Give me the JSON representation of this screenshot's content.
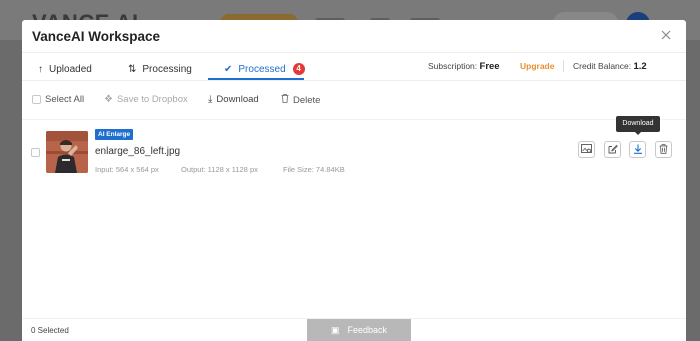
{
  "background": {
    "logo": "VANCE AI"
  },
  "modal": {
    "title": "VanceAI Workspace",
    "close_icon": "close-icon"
  },
  "tabs": [
    {
      "label": "Uploaded",
      "icon": "upload-arrow-icon"
    },
    {
      "label": "Processing",
      "icon": "sync-icon"
    },
    {
      "label": "Processed",
      "icon": "check-circle-icon",
      "badge": "4",
      "active": true
    }
  ],
  "account": {
    "subscription_label": "Subscription:",
    "subscription_value": "Free",
    "upgrade_label": "Upgrade",
    "credit_label": "Credit Balance:",
    "credit_value": "1.2"
  },
  "toolbar": {
    "select_all": "Select All",
    "save_to_dropbox": "Save to Dropbox",
    "download": "Download",
    "delete": "Delete"
  },
  "files": [
    {
      "tag": "AI Enlarge",
      "name": "enlarge_86_left.jpg",
      "input": "Input: 564 x 564 px",
      "output": "Output: 1128 x 1128 px",
      "size": "File Size: 74.84KB"
    }
  ],
  "tooltip": "Download",
  "footer": {
    "selected": "0  Selected",
    "feedback": "Feedback"
  },
  "colors": {
    "accent": "#1f6fd0",
    "badge": "#e53935",
    "upgrade": "#e8912d"
  }
}
